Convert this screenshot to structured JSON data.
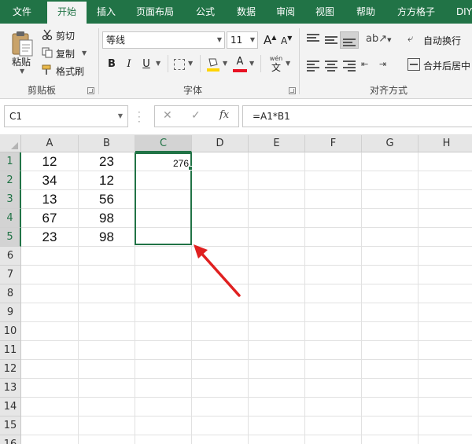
{
  "ribbon_tabs": [
    "文件",
    "开始",
    "插入",
    "页面布局",
    "公式",
    "数据",
    "审阅",
    "视图",
    "帮助",
    "方方格子",
    "DIY"
  ],
  "active_tab_index": 1,
  "clipboard": {
    "paste_label": "粘贴",
    "cut_label": "剪切",
    "copy_label": "复制",
    "format_painter_label": "格式刷",
    "group_label": "剪贴板"
  },
  "font": {
    "name": "等线",
    "size": "11",
    "grow_label": "A",
    "shrink_label": "A",
    "bold_label": "B",
    "italic_label": "I",
    "underline_label": "U",
    "phonetic_top": "wén",
    "phonetic_char": "文",
    "group_label": "字体"
  },
  "alignment": {
    "wrap_text_label": "自动换行",
    "merge_center_label": "合并后居中",
    "group_label": "对齐方式"
  },
  "formula_bar": {
    "name_box": "C1",
    "cancel_symbol": "✕",
    "enter_symbol": "✓",
    "fx_label": "fx",
    "formula": "=A1*B1"
  },
  "columns": [
    "A",
    "B",
    "C",
    "D",
    "E",
    "F",
    "G",
    "H"
  ],
  "rows": [
    "1",
    "2",
    "3",
    "4",
    "5",
    "6",
    "7",
    "8",
    "9",
    "10",
    "11",
    "12",
    "13",
    "14",
    "15",
    "16"
  ],
  "cells": {
    "A1": "12",
    "B1": "23",
    "C1": "276",
    "A2": "34",
    "B2": "12",
    "A3": "13",
    "B3": "56",
    "A4": "67",
    "B4": "98",
    "A5": "23",
    "B5": "98"
  },
  "selection": "C1:C5",
  "colors": {
    "accent": "#217346",
    "arrow": "#e02020"
  }
}
